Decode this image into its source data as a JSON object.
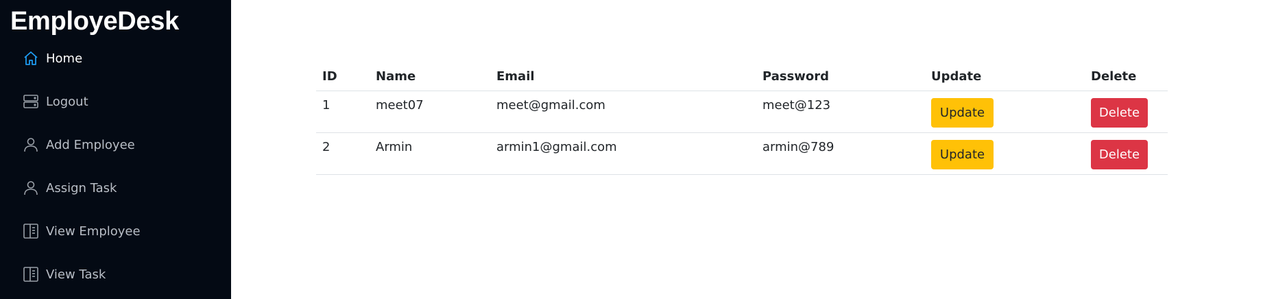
{
  "brand": "EmployeDesk",
  "sidebar": {
    "items": [
      {
        "label": "Home",
        "icon": "home-icon",
        "active": true
      },
      {
        "label": "Logout",
        "icon": "server-icon"
      },
      {
        "label": "Add Employee",
        "icon": "person-icon"
      },
      {
        "label": "Assign Task",
        "icon": "person-icon"
      },
      {
        "label": "View Employee",
        "icon": "layout-sidebar-icon"
      },
      {
        "label": "View Task",
        "icon": "layout-sidebar-icon"
      }
    ]
  },
  "table": {
    "headers": [
      "ID",
      "Name",
      "Email",
      "Password",
      "Update",
      "Delete"
    ],
    "rows": [
      {
        "id": "1",
        "name": "meet07",
        "email": "meet@gmail.com",
        "password": "meet@123",
        "update": "Update",
        "delete": "Delete"
      },
      {
        "id": "2",
        "name": "Armin",
        "email": "armin1@gmail.com",
        "password": "armin@789",
        "update": "Update",
        "delete": "Delete"
      }
    ]
  },
  "colors": {
    "sidebar_bg": "#040a14",
    "active_icon": "#1e9bf0",
    "update_button": "#ffc107",
    "delete_button": "#dc3545"
  }
}
